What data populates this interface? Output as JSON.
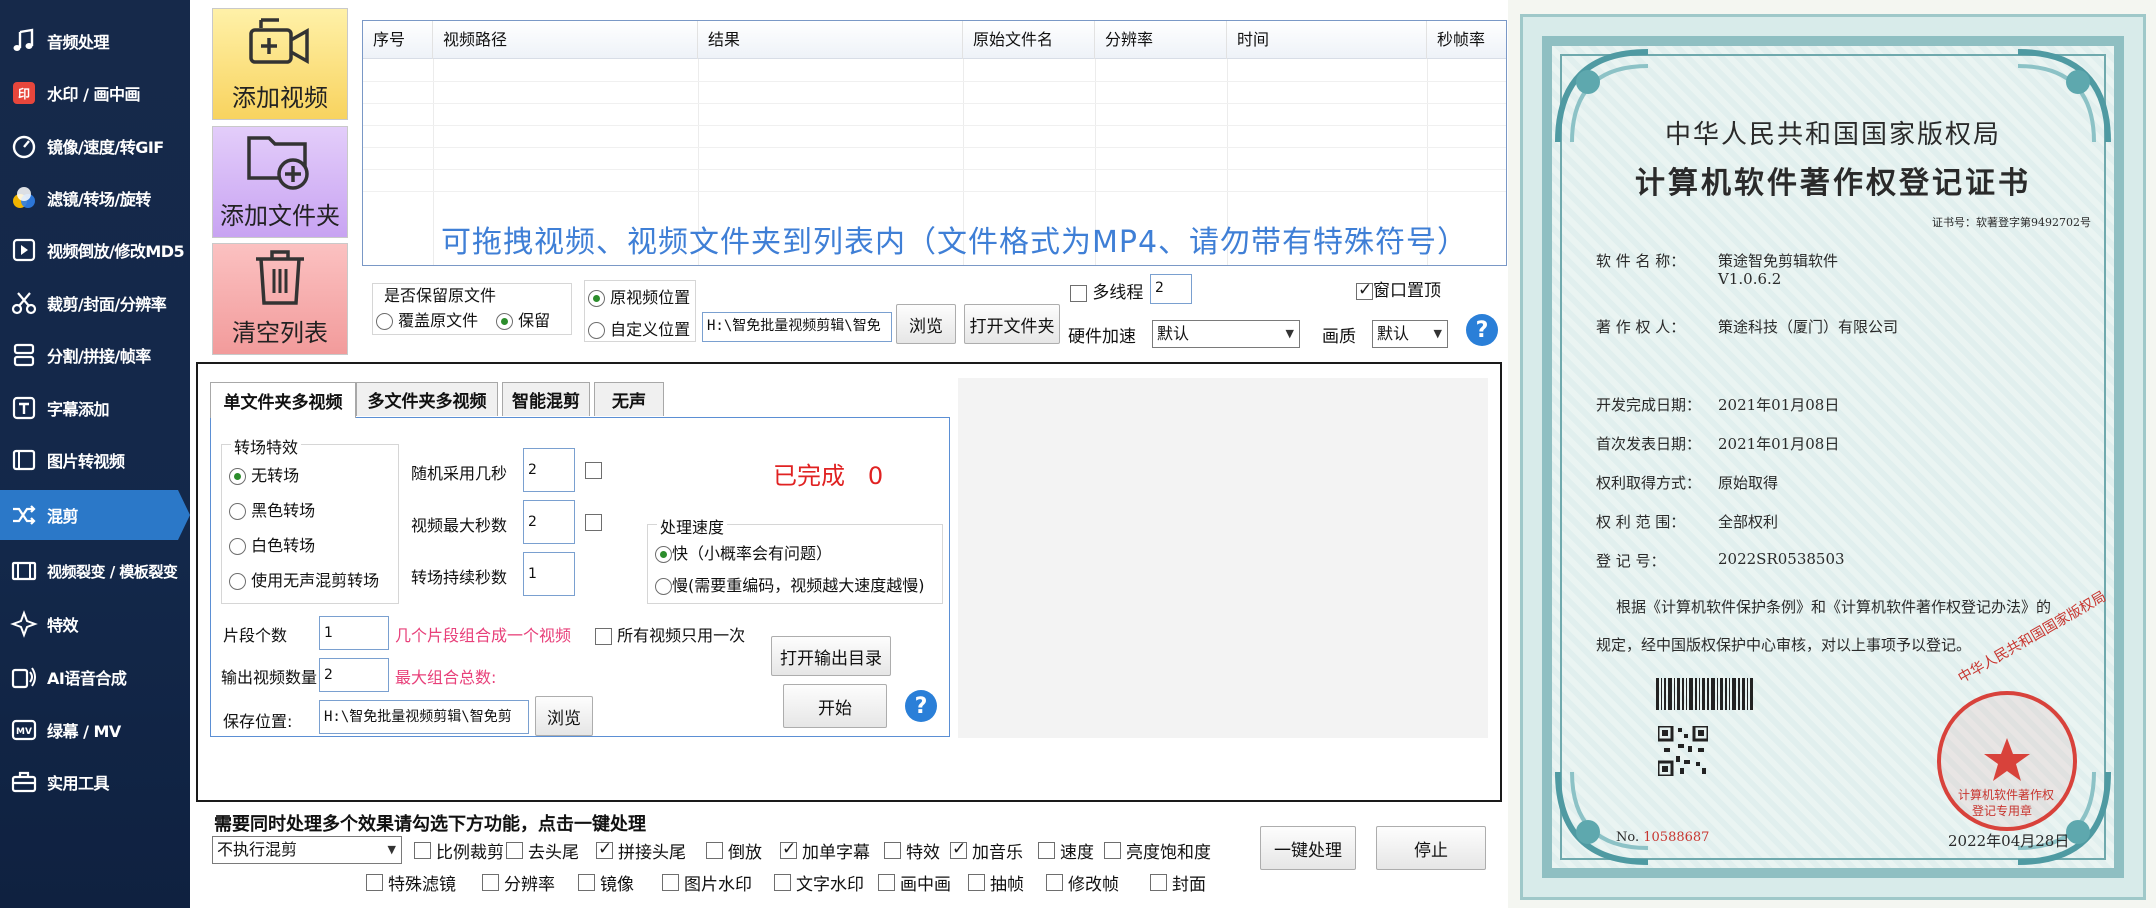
{
  "sidebar": {
    "items": [
      {
        "label": "音频处理",
        "icon": "music-note-icon"
      },
      {
        "label": "水印 / 画中画",
        "icon": "watermark-icon"
      },
      {
        "label": "镜像/速度/转GIF",
        "icon": "speedometer-icon"
      },
      {
        "label": "滤镜/转场/旋转",
        "icon": "filter-circles-icon"
      },
      {
        "label": "视频倒放/修改MD5",
        "icon": "video-play-icon"
      },
      {
        "label": "裁剪/封面/分辨率",
        "icon": "scissors-icon"
      },
      {
        "label": "分割/拼接/帧率",
        "icon": "split-icon"
      },
      {
        "label": "字幕添加",
        "icon": "subtitle-t-icon"
      },
      {
        "label": "图片转视频",
        "icon": "image-to-video-icon"
      },
      {
        "label": "混剪",
        "icon": "shuffle-icon"
      },
      {
        "label": "视频裂变 / 模板裂变",
        "icon": "film-icon"
      },
      {
        "label": "特效",
        "icon": "sparkle-icon"
      },
      {
        "label": "AI语音合成",
        "icon": "ai-voice-icon"
      },
      {
        "label": "绿幕 / MV",
        "icon": "mv-icon"
      },
      {
        "label": "实用工具",
        "icon": "toolbox-icon"
      }
    ],
    "active_index": 9
  },
  "tools": {
    "add_video": "添加视频",
    "add_folder": "添加文件夹",
    "clear_list": "清空列表"
  },
  "table": {
    "columns": [
      "序号",
      "视频路径",
      "结果",
      "原始文件名",
      "分辨率",
      "时间",
      "秒帧率"
    ],
    "drop_hint": "可拖拽视频、视频文件夹到列表内（文件格式为MP4、请勿带有特殊符号）"
  },
  "file_options": {
    "keep_original_label": "是否保留原文件",
    "overwrite_label": "覆盖原文件",
    "keep_label": "保留",
    "orig_position_label": "原视频位置",
    "custom_position_label": "自定义位置",
    "output_path": "H:\\智免批量视频剪辑\\智免",
    "browse_label": "浏览",
    "open_folder_label": "打开文件夹",
    "multithread_label": "多线程",
    "thread_count": "2",
    "hw_accel_label": "硬件加速",
    "hw_accel_value": "默认",
    "quality_label": "画质",
    "quality_value": "默认",
    "window_top_label": "窗口置顶"
  },
  "tabs": [
    "单文件夹多视频",
    "多文件夹多视频",
    "智能混剪",
    "无声"
  ],
  "mix": {
    "transition_group_title": "转场特效",
    "transitions": [
      "无转场",
      "黑色转场",
      "白色转场",
      "使用无声混剪转场"
    ],
    "random_seconds_label": "随机采用几秒",
    "random_seconds_value": "2",
    "max_seconds_label": "视频最大秒数",
    "max_seconds_value": "2",
    "transition_duration_label": "转场持续秒数",
    "transition_duration_value": "1",
    "completed_label": "已完成",
    "completed_count": "0",
    "speed_group_title": "处理速度",
    "speed_fast": "快（小概率会有问题）",
    "speed_slow": "慢(需要重编码，视频越大速度越慢)",
    "segments_label": "片段个数",
    "segments_value": "1",
    "segments_hint": "几个片段组合成一个视频",
    "use_once_label": "所有视频只用一次",
    "output_count_label": "输出视频数量",
    "output_count_value": "2",
    "max_combos_label": "最大组合总数:",
    "open_output_label": "打开输出目录",
    "save_location_label": "保存位置:",
    "save_path": "H:\\智免批量视频剪辑\\智免剪",
    "browse_label": "浏览",
    "start_label": "开始"
  },
  "bottom": {
    "title": "需要同时处理多个效果请勾选下方功能，点击一键处理",
    "select_value": "不执行混剪",
    "row1": [
      {
        "label": "比例裁剪",
        "checked": false
      },
      {
        "label": "去头尾",
        "checked": false
      },
      {
        "label": "拼接头尾",
        "checked": true
      },
      {
        "label": "倒放",
        "checked": false
      },
      {
        "label": "加单字幕",
        "checked": true
      },
      {
        "label": "特效",
        "checked": false
      },
      {
        "label": "加音乐",
        "checked": true
      },
      {
        "label": "速度",
        "checked": false
      },
      {
        "label": "亮度饱和度",
        "checked": false
      }
    ],
    "row2": [
      {
        "label": "特殊滤镜",
        "checked": false
      },
      {
        "label": "分辨率",
        "checked": false
      },
      {
        "label": "镜像",
        "checked": false
      },
      {
        "label": "图片水印",
        "checked": false
      },
      {
        "label": "文字水印",
        "checked": false
      },
      {
        "label": "画中画",
        "checked": false
      },
      {
        "label": "抽帧",
        "checked": false
      },
      {
        "label": "修改帧",
        "checked": false
      },
      {
        "label": "封面",
        "checked": false
      }
    ],
    "one_click_label": "一键处理",
    "stop_label": "停止"
  },
  "certificate": {
    "authority": "中华人民共和国国家版权局",
    "title": "计算机软件著作权登记证书",
    "cert_no": "证书号：软著登字第9492702号",
    "software_name_label": "软 件 名 称：",
    "software_name": "策途智免剪辑软件",
    "version": "V1.0.6.2",
    "owner_label": "著 作 权 人：",
    "owner": "策途科技（厦门）有限公司",
    "dev_date_label": "开发完成日期：",
    "dev_date": "2021年01月08日",
    "pub_date_label": "首次发表日期：",
    "pub_date": "2021年01月08日",
    "rights_method_label": "权利取得方式：",
    "rights_method": "原始取得",
    "rights_scope_label": "权 利 范 围：",
    "rights_scope": "全部权利",
    "reg_no_label": "登   记   号：",
    "reg_no": "2022SR0538503",
    "statement_1": "根据《计算机软件保护条例》和《计算机软件著作权登记办法》的",
    "statement_2": "规定，经中国版权保护中心审核，对以上事项予以登记。",
    "serial_label": "No.",
    "serial": "10588687",
    "seal_text": "中华人民共和国国家版权局",
    "seal_sub_1": "计算机软件著作权",
    "seal_sub_2": "登记专用章",
    "issue_date": "2022年04月28日"
  }
}
